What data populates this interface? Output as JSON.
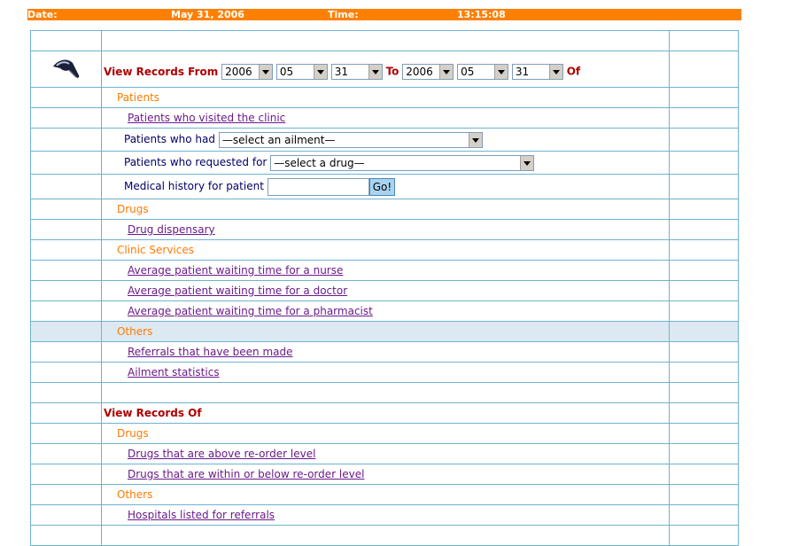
{
  "status_bar": {
    "date_label": "Date:",
    "date_value": "May 31, 2006",
    "time_label": "Time:",
    "time_value": "13:15:08"
  },
  "view_from": {
    "heading": "View Records From",
    "from_year": "2006",
    "from_month": "05",
    "from_day": "31",
    "to_label": "To",
    "to_year": "2006",
    "to_month": "05",
    "to_day": "31",
    "of_label": "Of"
  },
  "patients": {
    "title": "Patients",
    "visited_link": "Patients who visited the clinic",
    "had_label": "Patients who had",
    "ailment_select": "—select an ailment—",
    "requested_label": "Patients who requested for",
    "drug_select": "—select a drug—",
    "history_label": "Medical history for patient",
    "go_button": "Go!"
  },
  "drugs": {
    "title": "Drugs",
    "dispensary_link": "Drug dispensary"
  },
  "clinic_services": {
    "title": "Clinic Services",
    "nurse_link": "Average patient waiting time for a nurse",
    "doctor_link": "Average patient waiting time for a doctor",
    "pharmacist_link": "Average patient waiting time for a pharmacist"
  },
  "others": {
    "title": "Others",
    "referrals_link": "Referrals that have been made",
    "ailment_stats_link": "Ailment statistics"
  },
  "view_of": {
    "heading": "View Records Of",
    "drugs_title": "Drugs",
    "above_link": "Drugs that are above re-order level",
    "below_link": "Drugs that are within or below re-order level",
    "others_title": "Others",
    "hospitals_link": "Hospitals listed for referrals"
  },
  "icons": {
    "logo": "pointer-hand-icon"
  },
  "colors": {
    "status_bar": "#ff8000",
    "heading": "#b00000",
    "category": "#ff7a00",
    "link": "#6a1a8a",
    "grid_border": "#6fb3cf",
    "highlight_row": "#dde9f2"
  }
}
